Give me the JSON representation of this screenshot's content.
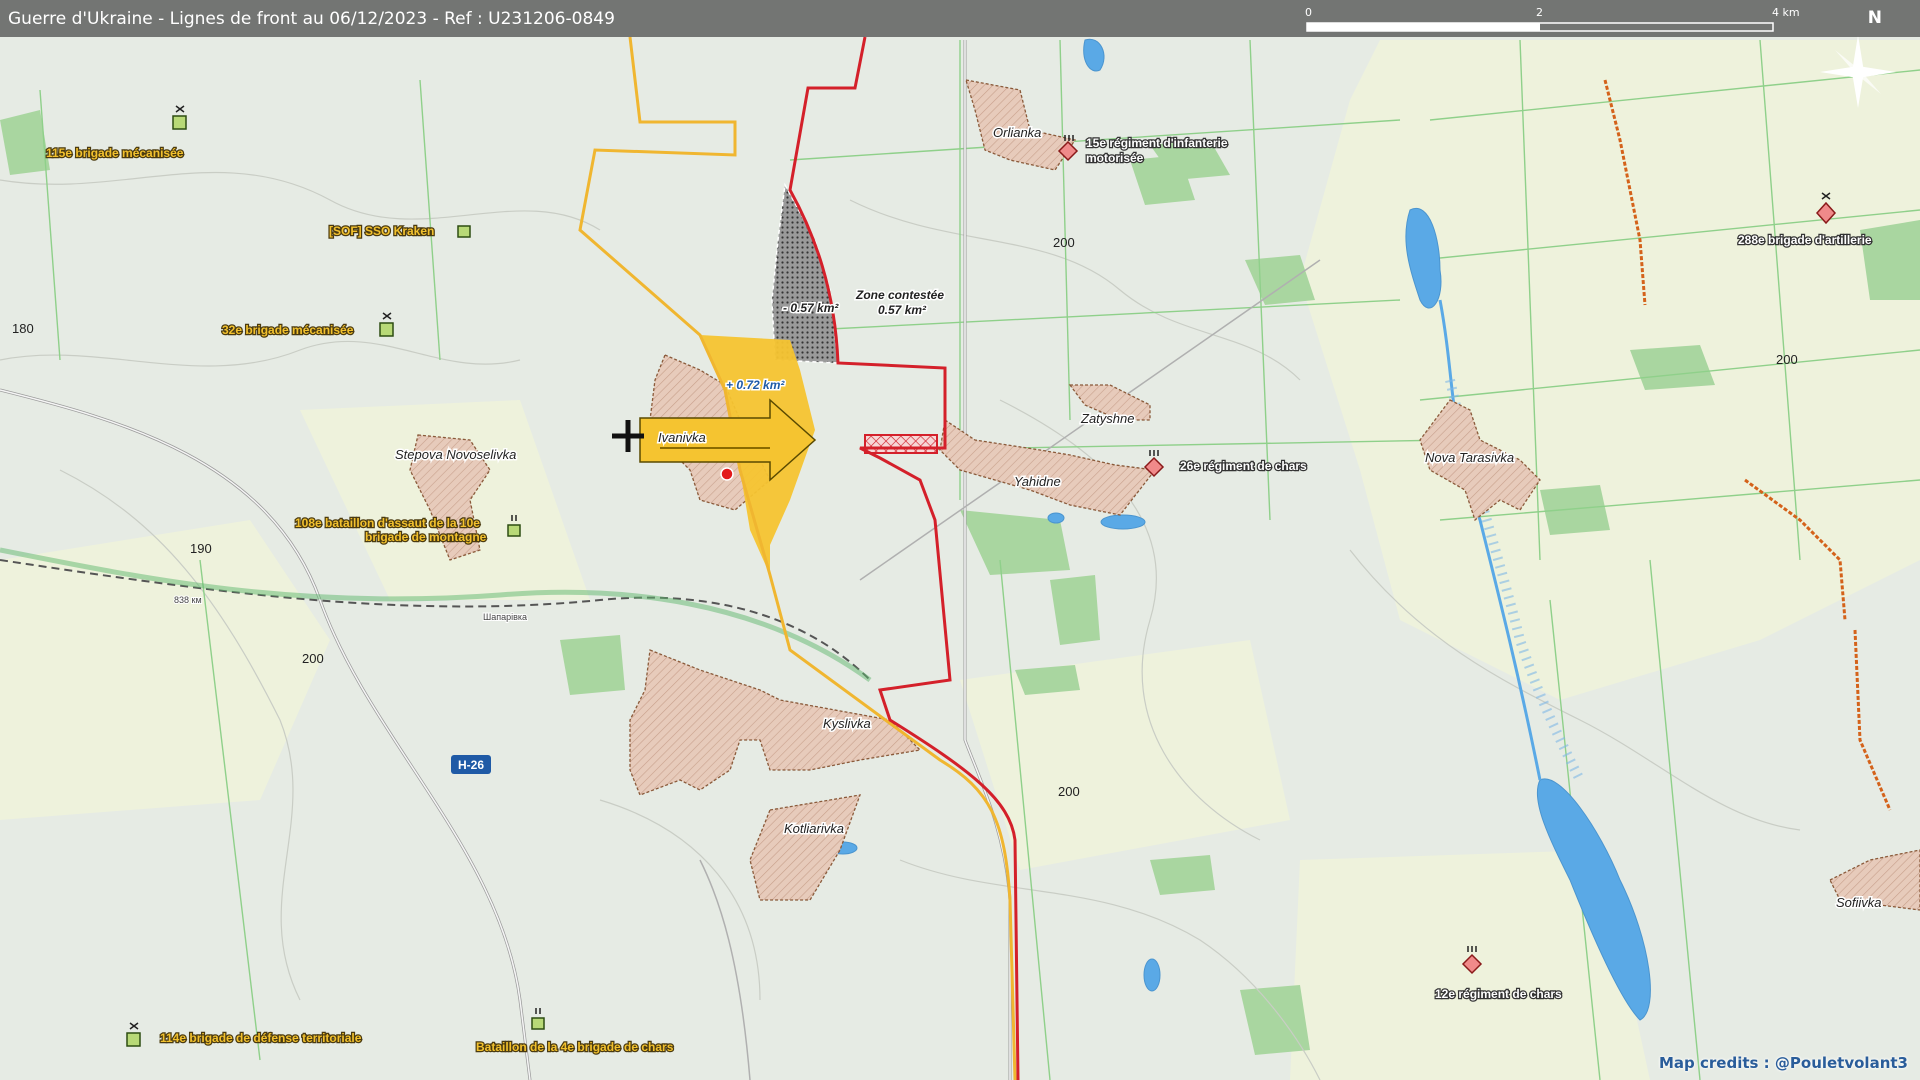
{
  "title": "Guerre d'Ukraine - Lignes de front au 06/12/2023 - Ref : U231206-0849",
  "credits": "Map credits : @Pouletvolant3",
  "scale": {
    "l0": "0",
    "l2": "2",
    "l4": "4 km"
  },
  "north": "N",
  "colors": {
    "ukraine_front": "#f0b630",
    "russia_front": "#d4202a",
    "gain": "#f5c430",
    "contested": "#808080",
    "settlement": "#e5c8b8",
    "water": "#5aa9e6",
    "forest": "#a9d6a0"
  },
  "icons": {
    "unit_ukraine": "green-unit-square",
    "unit_russia": "red-unit-diamond",
    "attack": "yellow-arrow",
    "battle": "black-cross"
  },
  "places": {
    "orlianka": "Orlianka",
    "zatyshne": "Zatyshne",
    "yahidne": "Yahidne",
    "ivanivka": "Ivanivka",
    "stepova": "Stepova Novoselivka",
    "kyslivka": "Kyslivka",
    "kotliarivka": "Kotliarivka",
    "nova": "Nova Tarasivka",
    "sofiivka": "Sofiivka",
    "shaparivka": "Шапарівка",
    "km838": "838 км",
    "road_h26": "H-26"
  },
  "elevations": {
    "e180": "180",
    "e190": "190",
    "e200a": "200",
    "e200b": "200",
    "e200c": "200",
    "e200d": "200"
  },
  "areas": {
    "gain": "+ 0.72 km²",
    "loss": "- 0.57 km²",
    "contested_l1": "Zone contestée",
    "contested_l2": "0.57 km²"
  },
  "units": {
    "u115": "115e brigade mécanisée",
    "usof": "[SOF] SSO Kraken",
    "u32": "32e brigade mécanisée",
    "u108a": "108e bataillon d'assaut de la 10e",
    "u108b": "brigade de montagne",
    "u114": "114e brigade de défense territoriale",
    "u4": "Bataillon de la 4e brigade de chars",
    "r15a": "15e régiment d'infanterie",
    "r15b": "motorisée",
    "r26": "26e régiment de chars",
    "r288": "288e brigade d'artillerie",
    "r12": "12e régiment de chars"
  }
}
